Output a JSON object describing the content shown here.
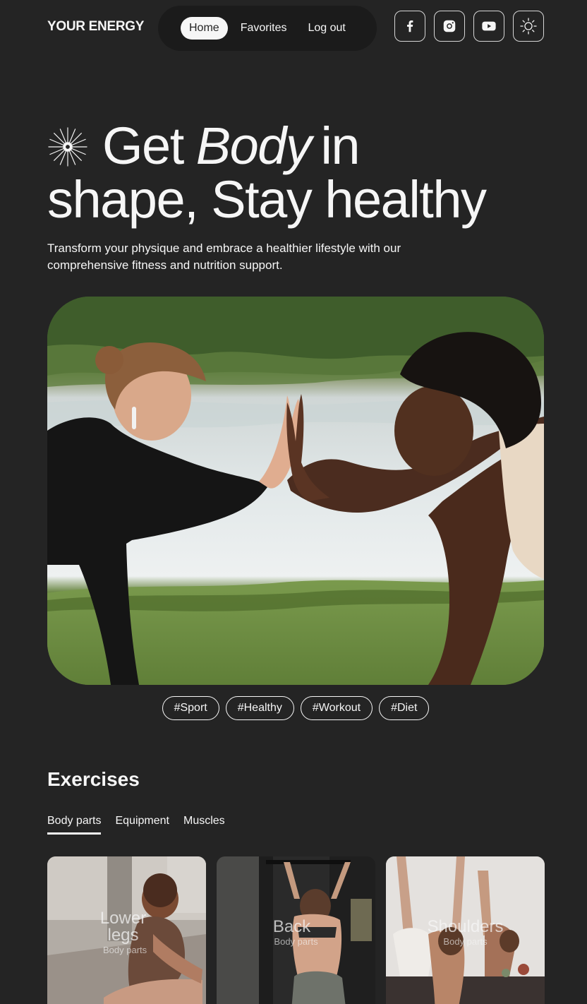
{
  "header": {
    "logo": "YOUR ENERGY",
    "nav": [
      {
        "label": "Home",
        "active": true
      },
      {
        "label": "Favorites",
        "active": false
      },
      {
        "label": "Log out",
        "active": false
      }
    ],
    "socials": [
      "facebook-icon",
      "instagram-icon",
      "youtube-icon",
      "sun-theme-icon"
    ]
  },
  "hero": {
    "title_part1": "Get",
    "title_emphasis": "Body",
    "title_part2": "in",
    "title_line2": "shape, Stay healthy",
    "subtitle": "Transform your physique and embrace a healthier lifestyle with our comprehensive fitness and nutrition support.",
    "tags": [
      "#Sport",
      "#Healthy",
      "#Workout",
      "#Diet"
    ]
  },
  "exercises": {
    "title": "Exercises",
    "filters": [
      {
        "label": "Body parts",
        "active": true
      },
      {
        "label": "Equipment",
        "active": false
      },
      {
        "label": "Muscles",
        "active": false
      }
    ],
    "cards": [
      {
        "name": "Lower legs",
        "category": "Body parts"
      },
      {
        "name": "Back",
        "category": "Body parts"
      },
      {
        "name": "Shoulders",
        "category": "Body parts"
      }
    ]
  },
  "colors": {
    "background": "#242424",
    "nav_background": "#1b1b1b",
    "text": "#f6f6f6"
  }
}
